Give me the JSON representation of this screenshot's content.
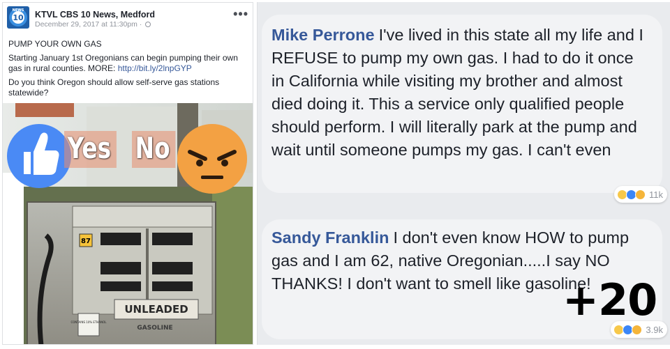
{
  "post": {
    "page_name": "KTVL CBS 10 News, Medford",
    "timestamp": "December 29, 2017 at 11:30pm",
    "avatar_text": "NEWS 10",
    "title": "PUMP YOUR OWN GAS",
    "body": "Starting January 1st Oregonians can begin pumping their own gas in rural counties. MORE:",
    "link": "http://bit.ly/2lnpGYP",
    "question": "Do you think Oregon should allow self-serve gas stations statewide?",
    "more_label": "•••"
  },
  "photo": {
    "yes_label": "Yes",
    "no_label": "No",
    "pump_price_tag": "87",
    "pump_sign": "UNLEADED",
    "pump_sign_sub": "GASOLINE",
    "ethanol_label": "CONTAINS 10% ETHANOL"
  },
  "comments": [
    {
      "author": "Mike Perrone",
      "text": "I've lived in this state all my life and I REFUSE to pump my own gas. I had to do it once in California while visiting my brother and almost died doing it. This a service only qualified people should perform. I will literally park at the pump and wait until someone pumps my gas. I can't even",
      "reactions_count": "11k"
    },
    {
      "author": "Sandy Franklin",
      "text": "I don't even know HOW to pump gas and I am 62, native Oregonian.....I say NO THANKS! I don't want to smell like gasoline!",
      "reactions_count": "3.9k"
    }
  ],
  "overlay": {
    "plus_count": "+20"
  },
  "colors": {
    "facebook_link": "#365899",
    "like_blue": "#4a8af5",
    "angry_orange": "#f0893d"
  }
}
